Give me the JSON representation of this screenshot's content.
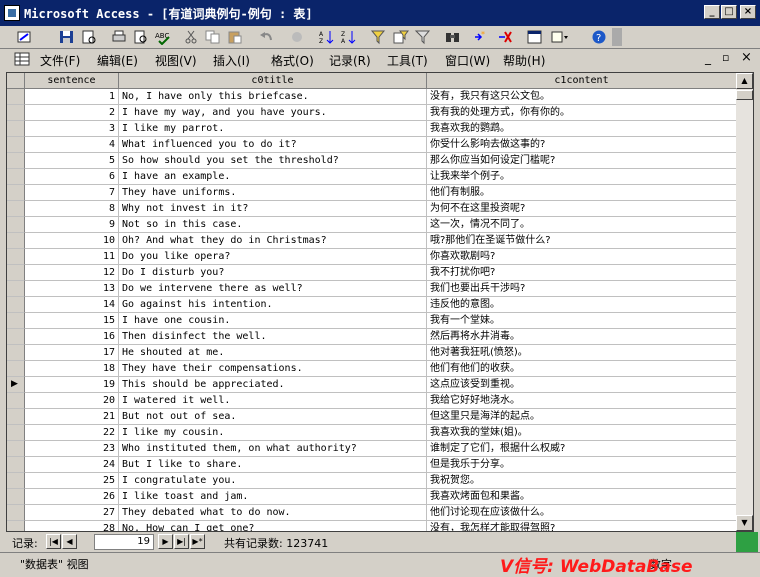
{
  "window": {
    "title": "Microsoft Access - [有道词典例句-例句 : 表]"
  },
  "menu": [
    "文件(F)",
    "编辑(E)",
    "视图(V)",
    "插入(I)",
    "格式(O)",
    "记录(R)",
    "工具(T)",
    "窗口(W)",
    "帮助(H)"
  ],
  "columns": [
    "sentence",
    "c0title",
    "c1content"
  ],
  "rows": [
    {
      "n": "1",
      "en": "No, I have only this briefcase.",
      "zh": "没有，我只有这只公文包。"
    },
    {
      "n": "2",
      "en": "I have my way, and you have yours.",
      "zh": "我有我的处理方式，你有你的。"
    },
    {
      "n": "3",
      "en": "I like my parrot.",
      "zh": "我喜欢我的鹦鹉。"
    },
    {
      "n": "4",
      "en": "What influenced you to do it?",
      "zh": "你受什么影响去做这事的?"
    },
    {
      "n": "5",
      "en": "So how should you set the threshold?",
      "zh": "那么你应当如何设定门槛呢?"
    },
    {
      "n": "6",
      "en": "I have an example.",
      "zh": "让我来举个例子。"
    },
    {
      "n": "7",
      "en": "They have uniforms.",
      "zh": "他们有制服。"
    },
    {
      "n": "8",
      "en": "Why not invest in it?",
      "zh": "为何不在这里投资呢?"
    },
    {
      "n": "9",
      "en": "Not so in this case.",
      "zh": "这一次，情况不同了。"
    },
    {
      "n": "10",
      "en": "Oh? And what they do in Christmas?",
      "zh": "哦?那他们在圣诞节做什么?"
    },
    {
      "n": "11",
      "en": "Do you like opera?",
      "zh": "你喜欢歌剧吗?"
    },
    {
      "n": "12",
      "en": "Do I disturb you?",
      "zh": "我不打扰你吧?"
    },
    {
      "n": "13",
      "en": "Do we intervene there as well?",
      "zh": "我们也要出兵干涉吗?"
    },
    {
      "n": "14",
      "en": "Go against his intention.",
      "zh": "违反他的意图。"
    },
    {
      "n": "15",
      "en": "I have one cousin.",
      "zh": "我有一个堂妹。"
    },
    {
      "n": "16",
      "en": "Then disinfect the well.",
      "zh": "然后再将水井消毒。"
    },
    {
      "n": "17",
      "en": "He shouted at me.",
      "zh": "他对著我狂吼(愤怒)。"
    },
    {
      "n": "18",
      "en": "They have their compensations.",
      "zh": "他们有他们的收获。"
    },
    {
      "n": "19",
      "en": "This should be appreciated.",
      "zh": "这点应该受到重视。"
    },
    {
      "n": "20",
      "en": "I watered it well.",
      "zh": "我给它好好地浇水。"
    },
    {
      "n": "21",
      "en": "But not out of sea.",
      "zh": "但这里只是海洋的起点。"
    },
    {
      "n": "22",
      "en": "I like my cousin.",
      "zh": "我喜欢我的堂妹(姐)。"
    },
    {
      "n": "23",
      "en": "Who instituted them, on what authority?",
      "zh": "谁制定了它们，根据什么权威?"
    },
    {
      "n": "24",
      "en": "But I like to share.",
      "zh": "但是我乐于分享。"
    },
    {
      "n": "25",
      "en": "I congratulate you.",
      "zh": "我祝贺您。"
    },
    {
      "n": "26",
      "en": "I like toast and jam.",
      "zh": "我喜欢烤面包和果酱。"
    },
    {
      "n": "27",
      "en": "They debated what to do now.",
      "zh": "他们讨论现在应该做什么。"
    },
    {
      "n": "28",
      "en": "No. How can I get one?",
      "zh": "没有，我怎样才能取得驾照?"
    }
  ],
  "current_row": "19",
  "nav": {
    "label": "记录:",
    "record": "19",
    "total": "共有记录数: 123741"
  },
  "status": {
    "left": "\"数据表\" 视图",
    "right": "数字"
  },
  "watermark": "V信号: WebDataBase",
  "colors": {
    "titlebar": "#0a246a",
    "face": "#d4d0c8",
    "watermark": "#ff1a1a"
  }
}
